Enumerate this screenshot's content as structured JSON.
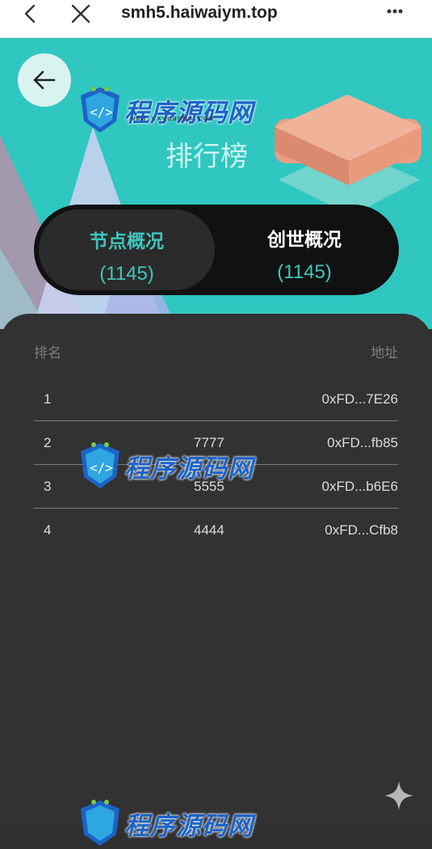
{
  "browser": {
    "url": "smh5.haiwaiym.top"
  },
  "hero": {
    "banner_text": "排行榜"
  },
  "watermark": {
    "text": "程序源码网",
    "sub": "www.cxyuanma.com"
  },
  "tabs": [
    {
      "label": "节点概况",
      "count": "(1145)"
    },
    {
      "label": "创世概况",
      "count": "(1145)"
    }
  ],
  "ranking": {
    "col_rank": "排名",
    "col_address": "地址",
    "rows": [
      {
        "rank": "1",
        "amount": "",
        "address": "0xFD...7E26"
      },
      {
        "rank": "2",
        "amount": "7777",
        "address": "0xFD...fb85"
      },
      {
        "rank": "3",
        "amount": "5555",
        "address": "0xFD...b6E6"
      },
      {
        "rank": "4",
        "amount": "4444",
        "address": "0xFD...Cfb8"
      }
    ]
  },
  "colors": {
    "accent": "#3fc6bd",
    "hero_bg": "#2fc7c0",
    "panel_bg": "#323232",
    "watermark": "#1d63c6"
  },
  "icons": [
    "back-icon",
    "close-icon",
    "more-icon",
    "arrow-left-icon",
    "sparkle-icon",
    "watermark-logo-icon"
  ]
}
